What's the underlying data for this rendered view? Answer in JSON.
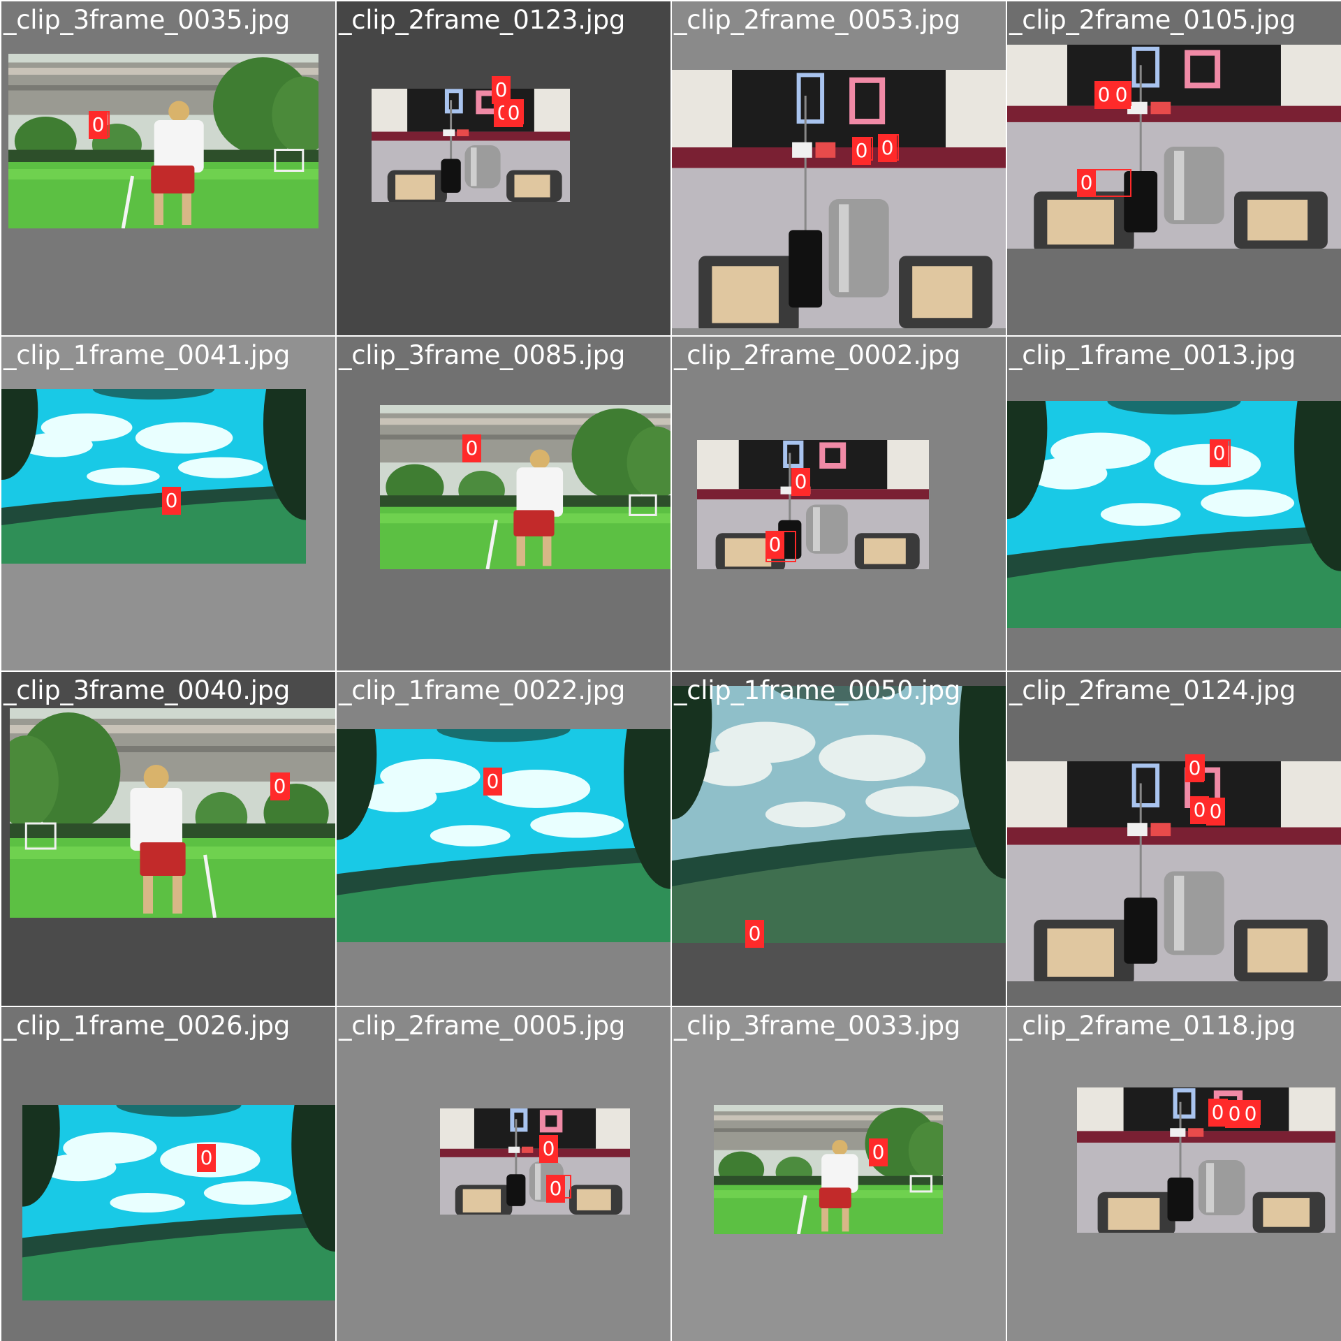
{
  "grid": {
    "tiles": [
      {
        "title": "_clip_3frame_0035.jpg",
        "bg": "#787878",
        "scene": "soccer",
        "flip": false,
        "detections": [
          {
            "label": "0"
          }
        ]
      },
      {
        "title": "_clip_2frame_0123.jpg",
        "bg": "#464646",
        "scene": "indoor-far",
        "detections": [
          {
            "label": "0"
          },
          {
            "label": "0"
          },
          {
            "label": "0"
          }
        ]
      },
      {
        "title": "_clip_2frame_0053.jpg",
        "bg": "#8a8a8a",
        "scene": "indoor-near",
        "detections": [
          {
            "label": "0"
          },
          {
            "label": "0"
          }
        ]
      },
      {
        "title": "_clip_2frame_0105.jpg",
        "bg": "#6e6e6e",
        "scene": "indoor-near",
        "detections": [
          {
            "label": "0"
          },
          {
            "label": "0"
          },
          {
            "label": "0"
          }
        ]
      },
      {
        "title": "_clip_1frame_0041.jpg",
        "bg": "#919191",
        "scene": "sky",
        "detections": [
          {
            "label": "0"
          }
        ]
      },
      {
        "title": "_clip_3frame_0085.jpg",
        "bg": "#717171",
        "scene": "soccer",
        "flip": false,
        "detections": [
          {
            "label": "0"
          }
        ]
      },
      {
        "title": "_clip_2frame_0002.jpg",
        "bg": "#838383",
        "scene": "indoor-far",
        "detections": [
          {
            "label": "0"
          },
          {
            "label": "0"
          }
        ]
      },
      {
        "title": "_clip_1frame_0013.jpg",
        "bg": "#787878",
        "scene": "sky",
        "detections": [
          {
            "label": "0"
          }
        ]
      },
      {
        "title": "_clip_3frame_0040.jpg",
        "bg": "#4b4b4b",
        "scene": "soccer",
        "flip": true,
        "detections": [
          {
            "label": "0"
          }
        ]
      },
      {
        "title": "_clip_1frame_0022.jpg",
        "bg": "#848484",
        "scene": "sky",
        "detections": [
          {
            "label": "0"
          }
        ]
      },
      {
        "title": "_clip_1frame_0050.jpg",
        "bg": "#515151",
        "scene": "sky-pale",
        "detections": [
          {
            "label": "0"
          }
        ]
      },
      {
        "title": "_clip_2frame_0124.jpg",
        "bg": "#6a6a6a",
        "scene": "indoor-near",
        "detections": [
          {
            "label": "0"
          },
          {
            "label": "0"
          },
          {
            "label": "0"
          }
        ]
      },
      {
        "title": "_clip_1frame_0026.jpg",
        "bg": "#737373",
        "scene": "sky",
        "detections": [
          {
            "label": "0"
          }
        ]
      },
      {
        "title": "_clip_2frame_0005.jpg",
        "bg": "#898989",
        "scene": "indoor-far",
        "detections": [
          {
            "label": "0"
          },
          {
            "label": "0"
          }
        ]
      },
      {
        "title": "_clip_3frame_0033.jpg",
        "bg": "#939393",
        "scene": "soccer",
        "flip": false,
        "detections": [
          {
            "label": "0"
          }
        ]
      },
      {
        "title": "_clip_2frame_0118.jpg",
        "bg": "#8c8c8c",
        "scene": "indoor-near",
        "detections": [
          {
            "label": "0"
          },
          {
            "label": "0"
          },
          {
            "label": "0"
          }
        ]
      }
    ]
  }
}
